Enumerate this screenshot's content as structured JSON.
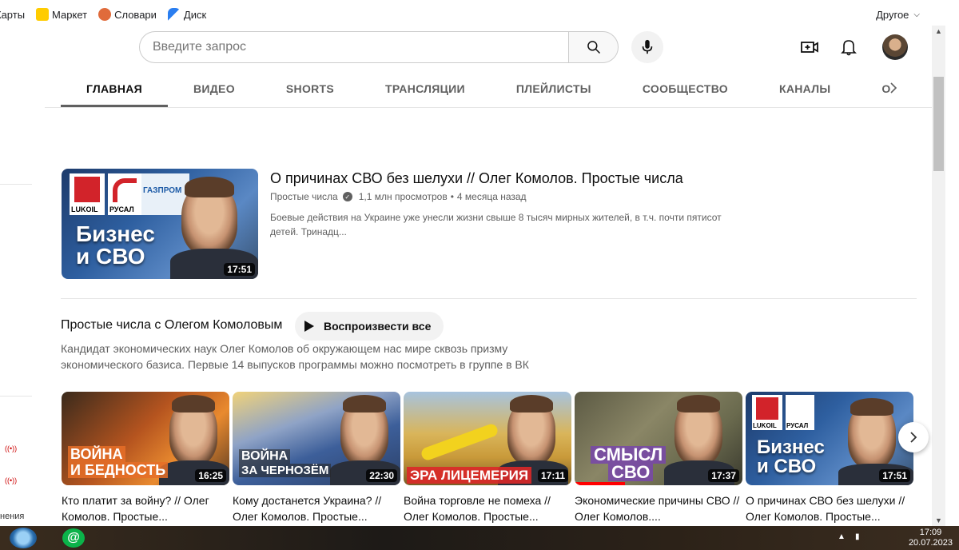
{
  "bookmarks": {
    "items": [
      {
        "label": "Карты",
        "icon": "maps-icon",
        "color": "#e84b3c"
      },
      {
        "label": "Маркет",
        "icon": "market-icon",
        "color": "#ffcc00"
      },
      {
        "label": "Словари",
        "icon": "dictionaries-icon",
        "color": "#e06b3b"
      },
      {
        "label": "Диск",
        "icon": "disk-icon",
        "color": "#2a7ef0"
      }
    ],
    "other": "Другое"
  },
  "header": {
    "search_placeholder": "Введите запрос"
  },
  "tabs": [
    "ГЛАВНАЯ",
    "ВИДЕО",
    "SHORTS",
    "ТРАНСЛЯЦИИ",
    "ПЛЕЙЛИСТЫ",
    "СООБЩЕСТВО",
    "КАНАЛЫ",
    "О"
  ],
  "featured": {
    "title": "О причинах СВО без шелухи // Олег Комолов. Простые числа",
    "channel": "Простые числа",
    "views": "1,1 млн просмотров",
    "age": "4 месяца назад",
    "description": "Боевые действия на Украине уже унесли жизни свыше 8 тысяч мирных жителей, в т.ч. почти пятисот детей. Тринадц...",
    "duration": "17:51",
    "thumb_text_line1": "Бизнес",
    "thumb_text_line2": "и СВО",
    "logo_lukoil": "LUKOIL",
    "logo_rusal": "РУСАЛ",
    "logo_gazprom": "ГАЗПРОМ"
  },
  "playlist": {
    "title": "Простые числа с Олегом Комоловым",
    "play_all": "Воспроизвести все",
    "description": "Кандидат экономических наук Олег Комолов об окружающем нас мире сквозь призму экономического базиса. Первые 14 выпусков программы можно посмотреть в группе в ВК"
  },
  "cards": [
    {
      "title": "Кто платит за войну? // Олег Комолов. Простые...",
      "duration": "16:25",
      "caption1": "ВОЙНА",
      "caption2": "И БЕДНОСТЬ",
      "bg": "#b5541f",
      "progress": 0
    },
    {
      "title": "Кому достанется Украина? // Олег Комолов. Простые...",
      "duration": "22:30",
      "caption1": "ВОЙНА",
      "caption2": "ЗА ЧЕРНОЗЁМ",
      "bg": "#8fa3c6",
      "progress": 0
    },
    {
      "title": "Война торговле не помеха // Олег Комолов. Простые...",
      "duration": "17:11",
      "caption1": "ЭРА ЛИЦЕМЕРИЯ",
      "caption2": "",
      "bg": "#c99a3a",
      "progress": 0
    },
    {
      "title": "Экономические причины СВО // Олег Комолов....",
      "duration": "17:37",
      "caption1": "СМЫСЛ",
      "caption2": "СВО",
      "bg": "#6a6a4e",
      "progress": 0.3
    },
    {
      "title": "О причинах СВО без шелухи // Олег Комолов. Простые...",
      "duration": "17:51",
      "caption1": "Бизнес",
      "caption2": "и СВО",
      "bg": "#2e5fa0",
      "progress": 0
    }
  ],
  "sidebar": {
    "fragment": "нения"
  },
  "taskbar": {
    "time": "17:09",
    "date": "20.07.2023"
  }
}
